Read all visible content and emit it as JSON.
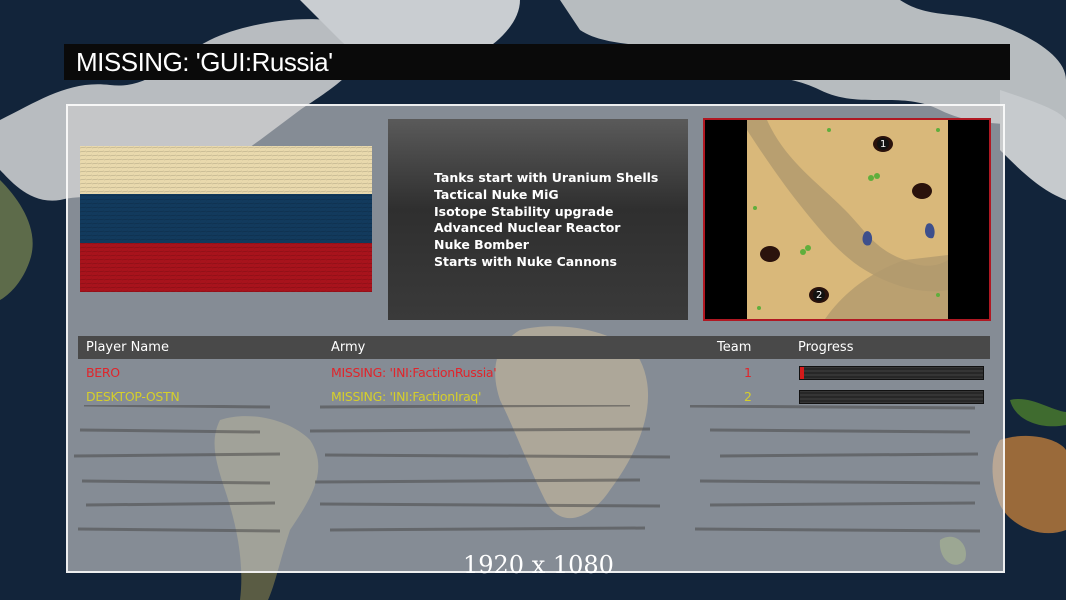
{
  "screen_title": "MISSING: 'GUI:Russia'",
  "faction": {
    "flag_name": "russia-flag",
    "flag_colors": [
      "#e9d9ad",
      "#123a5d",
      "#a8131c"
    ]
  },
  "bonuses": [
    "Tanks start with Uranium Shells",
    "Tactical Nuke MiG",
    "Isotope Stability upgrade",
    "Advanced Nuclear Reactor",
    "Nuke Bomber",
    "Starts with Nuke Cannons"
  ],
  "minimap": {
    "start_positions": [
      "1",
      "2"
    ],
    "border_color": "#b01822"
  },
  "table": {
    "headers": {
      "player": "Player Name",
      "army": "Army",
      "team": "Team",
      "progress": "Progress"
    },
    "rows": [
      {
        "player": "BERO",
        "army": "MISSING: 'INI:FactionRussia'",
        "team": "1",
        "progress": 0.02,
        "color": "#e0252b"
      },
      {
        "player": "DESKTOP-OSTN",
        "army": "MISSING: 'INI:FactionIraq'",
        "team": "2",
        "progress": 0.0,
        "color": "#d6cf2a"
      }
    ]
  },
  "resolution_label": "1920 x 1080"
}
